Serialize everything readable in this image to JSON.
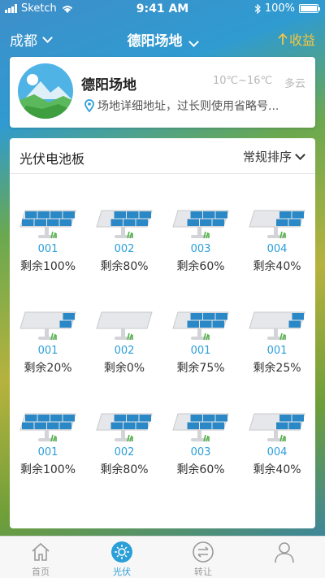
{
  "status": {
    "carrier": "Sketch",
    "time": "9:41 AM",
    "battery": "100%"
  },
  "header": {
    "city": "成都",
    "site_title": "德阳场地",
    "income": "收益"
  },
  "site": {
    "name": "德阳场地",
    "temp_range": "10℃~16℃",
    "weather": "多云",
    "address": "场地详细地址，过长则使用省略号..."
  },
  "panel_list": {
    "title": "光伏电池板",
    "sort_label": "常规排序",
    "items": [
      {
        "id": "001",
        "remaining": "剩余100%",
        "level": 1.0
      },
      {
        "id": "002",
        "remaining": "剩余80%",
        "level": 0.8
      },
      {
        "id": "003",
        "remaining": "剩余60%",
        "level": 0.6
      },
      {
        "id": "004",
        "remaining": "剩余40%",
        "level": 0.4
      },
      {
        "id": "001",
        "remaining": "剩余20%",
        "level": 0.2
      },
      {
        "id": "002",
        "remaining": "剩余0%",
        "level": 0.0
      },
      {
        "id": "001",
        "remaining": "剩余75%",
        "level": 0.75
      },
      {
        "id": "001",
        "remaining": "剩余25%",
        "level": 0.25
      },
      {
        "id": "001",
        "remaining": "剩余100%",
        "level": 1.0
      },
      {
        "id": "002",
        "remaining": "剩余80%",
        "level": 0.8
      },
      {
        "id": "003",
        "remaining": "剩余60%",
        "level": 0.6
      },
      {
        "id": "004",
        "remaining": "剩余40%",
        "level": 0.4
      }
    ]
  },
  "tabs": [
    {
      "label": "首页",
      "icon": "home-icon",
      "active": false
    },
    {
      "label": "光伏",
      "icon": "sun-icon",
      "active": true
    },
    {
      "label": "转让",
      "icon": "transfer-icon",
      "active": false
    },
    {
      "label": "",
      "icon": "user-icon",
      "active": false
    }
  ],
  "colors": {
    "accent": "#2b9fd8",
    "income": "#f3c642"
  }
}
